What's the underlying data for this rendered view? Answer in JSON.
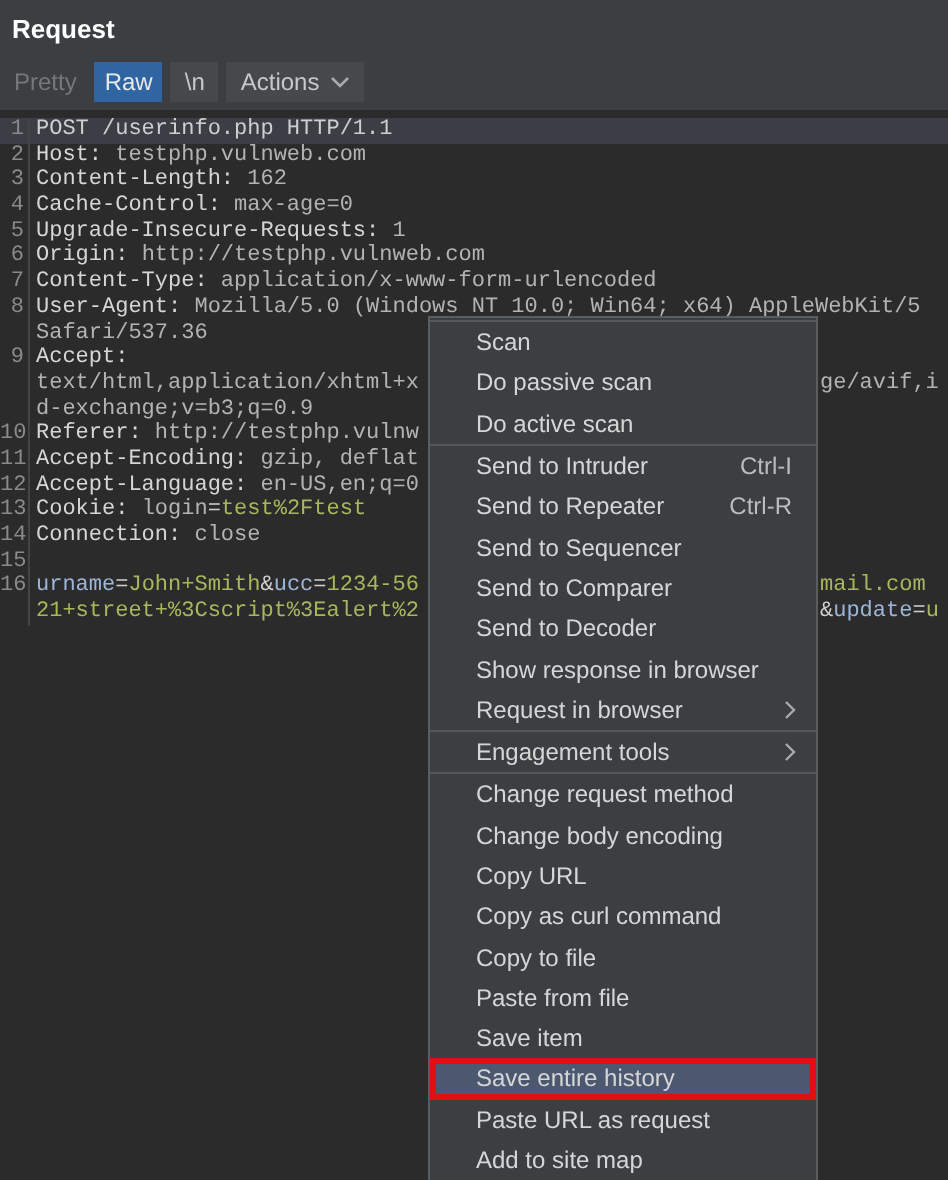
{
  "header": {
    "title": "Request"
  },
  "toolbar": {
    "tabs": [
      {
        "label": "Pretty",
        "selected": false
      },
      {
        "label": "Raw",
        "selected": true
      }
    ],
    "buttons": [
      {
        "label": "\\n",
        "kind": "plain"
      },
      {
        "label": "Actions",
        "kind": "dropdown"
      }
    ]
  },
  "editor": {
    "lines": [
      {
        "number": "1",
        "selected": true,
        "segments": [
          {
            "text": "POST /userinfo.php HTTP/1.1",
            "kind": "plain"
          }
        ]
      },
      {
        "number": "2",
        "selected": false,
        "segments": [
          {
            "text": "Host:",
            "kind": "name"
          },
          {
            "text": " testphp.vulnweb.com",
            "kind": "value"
          }
        ]
      },
      {
        "number": "3",
        "selected": false,
        "segments": [
          {
            "text": "Content-Length:",
            "kind": "name"
          },
          {
            "text": " 162",
            "kind": "value"
          }
        ]
      },
      {
        "number": "4",
        "selected": false,
        "segments": [
          {
            "text": "Cache-Control:",
            "kind": "name"
          },
          {
            "text": " max-age=0",
            "kind": "value"
          }
        ]
      },
      {
        "number": "5",
        "selected": false,
        "segments": [
          {
            "text": "Upgrade-Insecure-Requests:",
            "kind": "name"
          },
          {
            "text": " 1",
            "kind": "value"
          }
        ]
      },
      {
        "number": "6",
        "selected": false,
        "segments": [
          {
            "text": "Origin:",
            "kind": "name"
          },
          {
            "text": " http://testphp.vulnweb.com",
            "kind": "value"
          }
        ]
      },
      {
        "number": "7",
        "selected": false,
        "segments": [
          {
            "text": "Content-Type:",
            "kind": "name"
          },
          {
            "text": " application/x-www-form-urlencoded",
            "kind": "value"
          }
        ]
      },
      {
        "number": "8",
        "selected": false,
        "segments": [
          {
            "text": "User-Agent:",
            "kind": "name"
          },
          {
            "text": " Mozilla/5.0 (Windows NT 10.0; Win64; x64) AppleWebKit/5",
            "kind": "value"
          }
        ]
      },
      {
        "selected": false,
        "segments": [
          {
            "text": "Safari/537.36",
            "kind": "value"
          }
        ]
      },
      {
        "number": "9",
        "selected": false,
        "segments": [
          {
            "text": "Accept:",
            "kind": "name"
          }
        ]
      },
      {
        "selected": false,
        "segments": [
          {
            "text": "text/html,application/xhtml+x",
            "kind": "value"
          }
        ],
        "tail": [
          {
            "text": "ge/avif,i",
            "kind": "value"
          }
        ]
      },
      {
        "selected": false,
        "segments": [
          {
            "text": "d-exchange;v=b3;q=0.9",
            "kind": "value"
          }
        ]
      },
      {
        "number": "10",
        "selected": false,
        "segments": [
          {
            "text": "Referer:",
            "kind": "name"
          },
          {
            "text": " http://testphp.vulnw",
            "kind": "value"
          }
        ]
      },
      {
        "number": "11",
        "selected": false,
        "segments": [
          {
            "text": "Accept-Encoding:",
            "kind": "name"
          },
          {
            "text": " gzip, deflat",
            "kind": "value"
          }
        ]
      },
      {
        "number": "12",
        "selected": false,
        "segments": [
          {
            "text": "Accept-Language:",
            "kind": "name"
          },
          {
            "text": " en-US,en;q=0",
            "kind": "value"
          }
        ]
      },
      {
        "number": "13",
        "selected": false,
        "segments": [
          {
            "text": "Cookie:",
            "kind": "name"
          },
          {
            "text": " login",
            "kind": "value"
          },
          {
            "text": "=",
            "kind": "plain"
          },
          {
            "text": "test%2Ftest",
            "kind": "green"
          }
        ]
      },
      {
        "number": "14",
        "selected": false,
        "segments": [
          {
            "text": "Connection:",
            "kind": "name"
          },
          {
            "text": " close",
            "kind": "value"
          }
        ]
      },
      {
        "number": "15",
        "selected": false
      },
      {
        "number": "16",
        "selected": false,
        "segments": [
          {
            "text": "urname",
            "kind": "blue"
          },
          {
            "text": "=",
            "kind": "plain"
          },
          {
            "text": "John+Smith",
            "kind": "green"
          },
          {
            "text": "&",
            "kind": "plain"
          },
          {
            "text": "ucc",
            "kind": "blue"
          },
          {
            "text": "=",
            "kind": "plain"
          },
          {
            "text": "1234-56",
            "kind": "green"
          }
        ],
        "tail": [
          {
            "text": "mail.com",
            "kind": "green"
          }
        ]
      },
      {
        "selected": false,
        "segments": [
          {
            "text": "21+street+%3Cscript%3Ealert%2",
            "kind": "green"
          }
        ],
        "tail": [
          {
            "text": "&",
            "kind": "plain"
          },
          {
            "text": "update",
            "kind": "blue"
          },
          {
            "text": "=",
            "kind": "plain"
          },
          {
            "text": "u",
            "kind": "green"
          }
        ]
      }
    ]
  },
  "context_menu": {
    "groups": [
      [
        {
          "label": "Scan",
          "selected": false,
          "submenu": false,
          "outlined": false
        },
        {
          "label": "Do passive scan",
          "selected": false,
          "submenu": false,
          "outlined": false
        },
        {
          "label": "Do active scan",
          "selected": false,
          "submenu": false,
          "outlined": false
        }
      ],
      [
        {
          "label": "Send to Intruder",
          "shortcut": "Ctrl-I",
          "selected": false,
          "submenu": false,
          "outlined": false
        },
        {
          "label": "Send to Repeater",
          "shortcut": "Ctrl-R",
          "selected": false,
          "submenu": false,
          "outlined": false
        },
        {
          "label": "Send to Sequencer",
          "selected": false,
          "submenu": false,
          "outlined": false
        },
        {
          "label": "Send to Comparer",
          "selected": false,
          "submenu": false,
          "outlined": false
        },
        {
          "label": "Send to Decoder",
          "selected": false,
          "submenu": false,
          "outlined": false
        },
        {
          "label": "Show response in browser",
          "selected": false,
          "submenu": false,
          "outlined": false
        },
        {
          "label": "Request in browser",
          "selected": false,
          "submenu": true,
          "outlined": false
        }
      ],
      [
        {
          "label": "Engagement tools",
          "selected": false,
          "submenu": true,
          "outlined": false
        }
      ],
      [
        {
          "label": "Change request method",
          "selected": false,
          "submenu": false,
          "outlined": false
        },
        {
          "label": "Change body encoding",
          "selected": false,
          "submenu": false,
          "outlined": false
        },
        {
          "label": "Copy URL",
          "selected": false,
          "submenu": false,
          "outlined": false
        },
        {
          "label": "Copy as curl command",
          "selected": false,
          "submenu": false,
          "outlined": false
        },
        {
          "label": "Copy to file",
          "selected": false,
          "submenu": false,
          "outlined": false
        },
        {
          "label": "Paste from file",
          "selected": false,
          "submenu": false,
          "outlined": false
        },
        {
          "label": "Save item",
          "selected": false,
          "submenu": false,
          "outlined": false
        },
        {
          "label": "Save entire history",
          "selected": true,
          "submenu": false,
          "outlined": true
        },
        {
          "label": "Paste URL as request",
          "selected": false,
          "submenu": false,
          "outlined": false
        },
        {
          "label": "Add to site map",
          "selected": false,
          "submenu": false,
          "outlined": false
        }
      ]
    ]
  }
}
